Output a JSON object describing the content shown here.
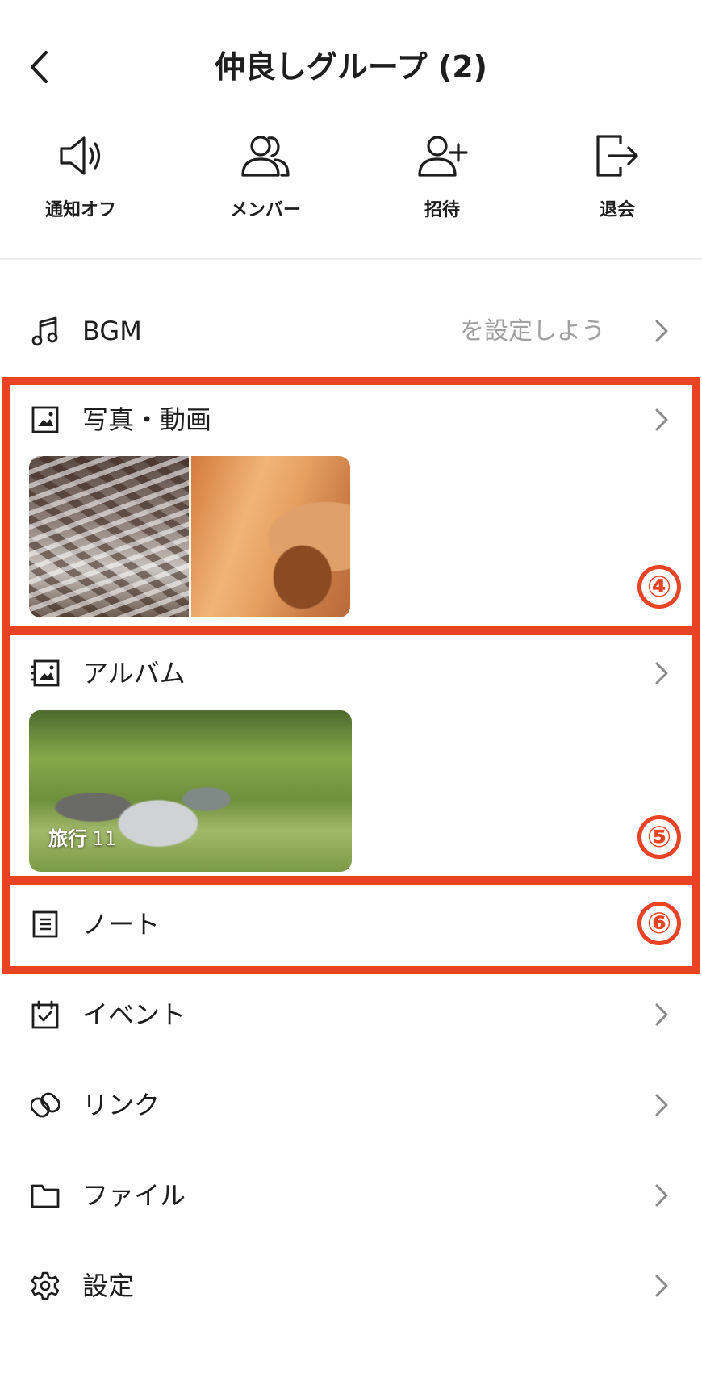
{
  "header": {
    "title": "仲良しグループ (2)"
  },
  "actions": [
    {
      "icon": "speaker-icon",
      "label": "通知オフ"
    },
    {
      "icon": "members-icon",
      "label": "メンバー"
    },
    {
      "icon": "invite-icon",
      "label": "招待"
    },
    {
      "icon": "exit-icon",
      "label": "退会"
    }
  ],
  "menu": {
    "bgm": {
      "label": "BGM",
      "sub": "を設定しよう！"
    },
    "photos": {
      "label": "写真・動画"
    },
    "album": {
      "label": "アルバム",
      "thumb_title": "旅行",
      "thumb_count": "11"
    },
    "note": {
      "label": "ノート"
    },
    "event": {
      "label": "イベント"
    },
    "link": {
      "label": "リンク"
    },
    "file": {
      "label": "ファイル"
    },
    "settings": {
      "label": "設定"
    }
  },
  "annotations": {
    "b4": "④",
    "b5": "⑤",
    "b6": "⑥"
  },
  "colors": {
    "highlight": "#e94325",
    "text": "#1e1e1e",
    "sub_text": "#a0a0a0"
  }
}
